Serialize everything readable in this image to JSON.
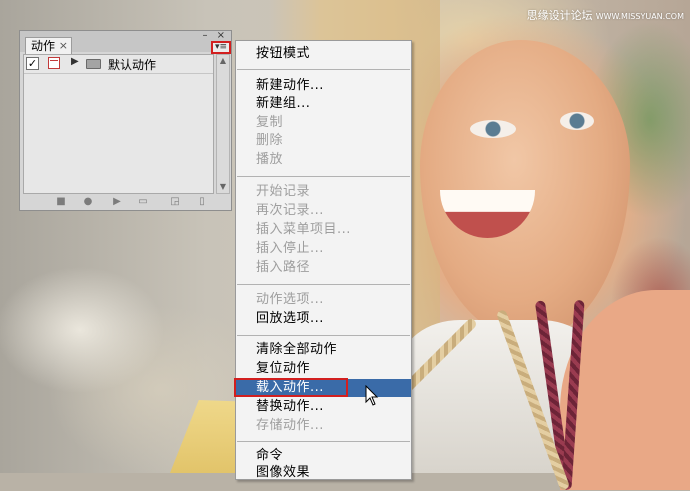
{
  "watermark": {
    "text": "思缘设计论坛",
    "url": "WWW.MISSYUAN.COM"
  },
  "panel": {
    "tab_label": "动作",
    "tab_close": "×",
    "window_controls": "– ×",
    "menu_button": "▾≡",
    "rows": [
      {
        "checked": "✓",
        "expand": "▶",
        "label": "默认动作"
      }
    ],
    "icons": [
      "stop-icon",
      "record-icon",
      "play-icon",
      "folder-icon",
      "new-action-icon",
      "delete-icon"
    ]
  },
  "menu": {
    "items": [
      {
        "label": "按钮模式",
        "enabled": true
      },
      {
        "label": "新建动作...",
        "enabled": true
      },
      {
        "label": "新建组...",
        "enabled": true
      },
      {
        "label": "复制",
        "enabled": false
      },
      {
        "label": "删除",
        "enabled": false
      },
      {
        "label": "播放",
        "enabled": false
      },
      {
        "label": "开始记录",
        "enabled": false
      },
      {
        "label": "再次记录...",
        "enabled": false
      },
      {
        "label": "插入菜单项目...",
        "enabled": false
      },
      {
        "label": "插入停止...",
        "enabled": false
      },
      {
        "label": "插入路径",
        "enabled": false
      },
      {
        "label": "动作选项...",
        "enabled": false
      },
      {
        "label": "回放选项...",
        "enabled": true
      },
      {
        "label": "清除全部动作",
        "enabled": true
      },
      {
        "label": "复位动作",
        "enabled": true
      },
      {
        "label": "载入动作...",
        "enabled": true,
        "highlighted": true
      },
      {
        "label": "替换动作...",
        "enabled": true
      },
      {
        "label": "存储动作...",
        "enabled": false
      },
      {
        "label": "命令",
        "enabled": true
      },
      {
        "label": "图像效果",
        "enabled": true
      }
    ]
  },
  "colors": {
    "highlight": "#3a6ba8",
    "annotation_box": "#d21f1f",
    "disabled_text": "#9e9e9e"
  }
}
